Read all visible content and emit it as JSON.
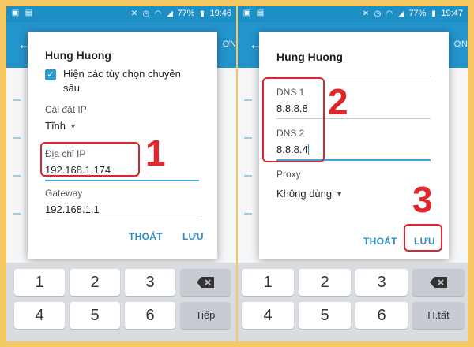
{
  "status": {
    "left": {
      "battery": "77%",
      "time": "19:46"
    },
    "right": {
      "battery": "77%",
      "time": "19:47"
    }
  },
  "appbar": {
    "edge_text": "ƠN"
  },
  "left_dialog": {
    "title": "Hung Huong",
    "checkbox_line1": "Hiện các tùy chọn chuyên",
    "checkbox_line2": "sâu",
    "ip_settings_label": "Cài đặt IP",
    "ip_settings_value": "Tĩnh",
    "ip_address_label": "Địa chỉ IP",
    "ip_address_value": "192.168.1.174",
    "gateway_label": "Gateway",
    "gateway_value": "192.168.1.1",
    "cancel": "THOÁT",
    "save": "LƯU"
  },
  "right_dialog": {
    "title": "Hung Huong",
    "dns1_label": "DNS 1",
    "dns1_value": "8.8.8.8",
    "dns2_label": "DNS 2",
    "dns2_value": "8.8.8.4",
    "proxy_label": "Proxy",
    "proxy_value": "Không dùng",
    "cancel": "THOÁT",
    "save": "LƯU"
  },
  "steps": [
    "1",
    "2",
    "3"
  ],
  "keyboard_left": {
    "row1": [
      "1",
      "2",
      "3"
    ],
    "row2": [
      "4",
      "5",
      "6"
    ],
    "next": "Tiếp"
  },
  "keyboard_right": {
    "row1": [
      "1",
      "2",
      "3"
    ],
    "row2": [
      "4",
      "5",
      "6"
    ],
    "done": "H.tất"
  },
  "colors": {
    "status_bar": "#1e8fc4",
    "accent": "#2d8fc4",
    "callout": "#e0262b",
    "frame": "#f6c863"
  }
}
